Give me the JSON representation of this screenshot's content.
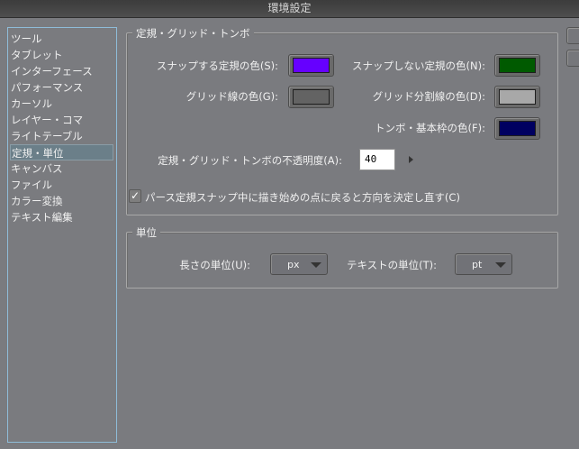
{
  "window": {
    "title": "環境設定"
  },
  "sidebar": {
    "items": [
      {
        "label": "ツール"
      },
      {
        "label": "タブレット"
      },
      {
        "label": "インターフェース"
      },
      {
        "label": "パフォーマンス"
      },
      {
        "label": "カーソル"
      },
      {
        "label": "レイヤー・コマ"
      },
      {
        "label": "ライトテーブル"
      },
      {
        "label": "定規・単位",
        "selected": true
      },
      {
        "label": "キャンバス"
      },
      {
        "label": "ファイル"
      },
      {
        "label": "カラー変換"
      },
      {
        "label": "テキスト編集"
      }
    ]
  },
  "ruler_group": {
    "title": "定規・グリッド・トンボ",
    "snap_color_label": "スナップする定規の色(S):",
    "snap_color": "#6600ff",
    "nosnap_color_label": "スナップしない定規の色(N):",
    "nosnap_color": "#005a00",
    "grid_color_label": "グリッド線の色(G):",
    "grid_color": "#636363",
    "grid_div_color_label": "グリッド分割線の色(D):",
    "grid_div_color": "#a8a8a8",
    "crop_color_label": "トンボ・基本枠の色(F):",
    "crop_color": "#000060",
    "opacity_label": "定規・グリッド・トンボの不透明度(A):",
    "opacity_value": "40",
    "perspective_checkbox_label": "パース定規スナップ中に描き始めの点に戻ると方向を決定し直す(C)",
    "perspective_checked": true
  },
  "unit_group": {
    "title": "単位",
    "length_label": "長さの単位(U):",
    "length_value": "px",
    "text_label": "テキストの単位(T):",
    "text_value": "pt"
  }
}
